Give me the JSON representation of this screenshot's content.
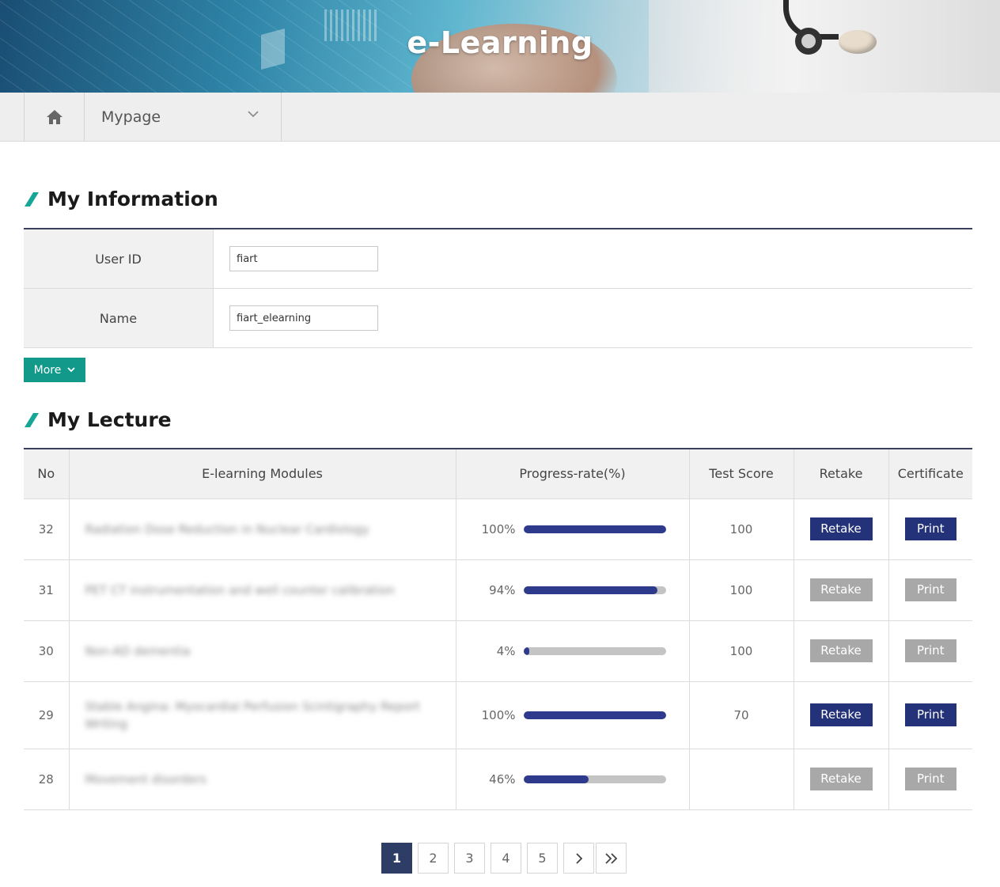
{
  "banner": {
    "title": "e-Learning"
  },
  "nav": {
    "home_icon": "home-icon",
    "current": "Mypage"
  },
  "info_section": {
    "title": "My Information",
    "rows": [
      {
        "label": "User ID",
        "value": "fiart"
      },
      {
        "label": "Name",
        "value": "fiart_elearning"
      }
    ],
    "more_label": "More"
  },
  "lecture_section": {
    "title": "My Lecture",
    "headers": [
      "No",
      "E-learning Modules",
      "Progress-rate(%)",
      "Test Score",
      "Retake",
      "Certificate"
    ],
    "rows": [
      {
        "no": "32",
        "module": "Radiation Dose Reduction in Nuclear Cardiology",
        "progress": 100,
        "progress_label": "100%",
        "score": "100",
        "retake": "Retake",
        "retake_active": true,
        "print": "Print",
        "print_active": true
      },
      {
        "no": "31",
        "module": "PET CT instrumentation and well counter calibration",
        "progress": 94,
        "progress_label": "94%",
        "score": "100",
        "retake": "Retake",
        "retake_active": false,
        "print": "Print",
        "print_active": false
      },
      {
        "no": "30",
        "module": "Non-AD dementia",
        "progress": 4,
        "progress_label": "4%",
        "score": "100",
        "retake": "Retake",
        "retake_active": false,
        "print": "Print",
        "print_active": false
      },
      {
        "no": "29",
        "module": "Stable Angina: Myocardial Perfusion Scintigraphy Report Writing",
        "progress": 100,
        "progress_label": "100%",
        "score": "70",
        "retake": "Retake",
        "retake_active": true,
        "print": "Print",
        "print_active": true
      },
      {
        "no": "28",
        "module": "Movement disorders",
        "progress": 46,
        "progress_label": "46%",
        "score": "",
        "retake": "Retake",
        "retake_active": false,
        "print": "Print",
        "print_active": false
      }
    ]
  },
  "pagination": {
    "pages": [
      "1",
      "2",
      "3",
      "4",
      "5"
    ],
    "current": "1",
    "next_icon": "chevron-right-icon",
    "last_icon": "double-chevron-right-icon"
  },
  "colors": {
    "accent_teal": "#13998a",
    "primary_navy": "#24327a",
    "inactive_gray": "#a8a8a8",
    "pager_active": "#2e3d66"
  }
}
